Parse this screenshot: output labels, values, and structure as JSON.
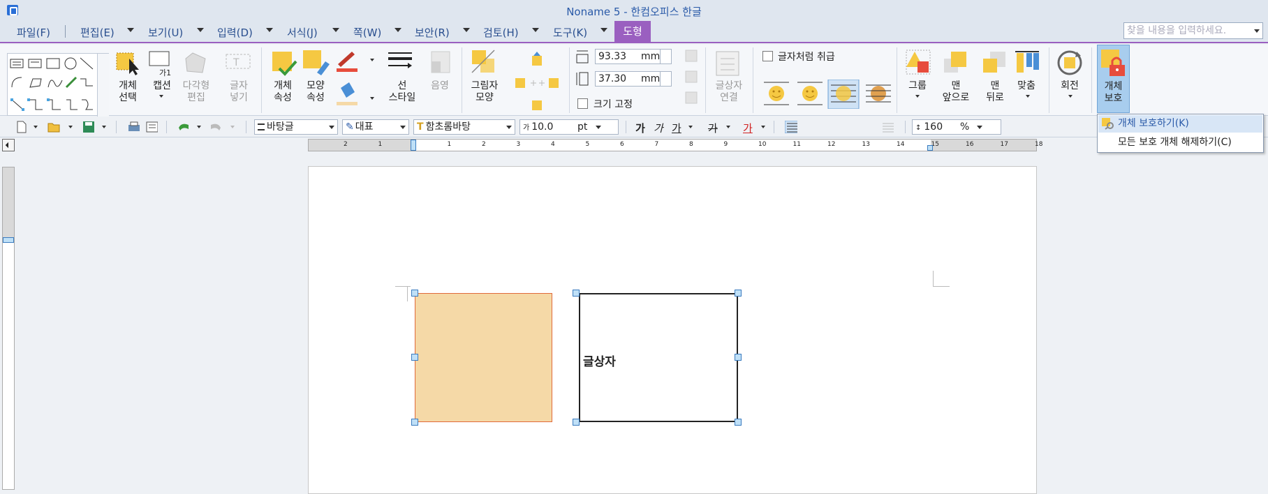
{
  "window": {
    "title": "Noname 5 - 한컴오피스 한글"
  },
  "menubar": {
    "items": [
      "파일(F)",
      "편집(E)",
      "보기(U)",
      "입력(D)",
      "서식(J)",
      "쪽(W)",
      "보안(R)",
      "검토(H)",
      "도구(K)"
    ],
    "active_tab": "도형",
    "search_placeholder": "찾을 내용을 입력하세요."
  },
  "ribbon": {
    "select_object": "개체\n선택",
    "caption": "캡션",
    "polygon_edit": "다각형\n편집",
    "insert_text": "글자\n넣기",
    "object_props": "개체\n속성",
    "shape_props": "모양\n속성",
    "line_style": "선\n스타일",
    "shade": "음영",
    "shadow_shape": "그림자\n모양",
    "width_value": "93.33",
    "height_value": "37.30",
    "unit": "mm",
    "fix_size": "크기 고정",
    "textbox_link": "글상자\n연결",
    "treat_as_char": "글자처럼 취급",
    "group": "그룹",
    "bring_front": "맨\n앞으로",
    "send_back": "맨\n뒤로",
    "align": "맞춤",
    "rotate": "회전",
    "protect": "개체\n보호"
  },
  "formatbar": {
    "style": "바탕글",
    "lang": "대표",
    "font": "함초롬바탕",
    "size": "10.0",
    "size_unit": "pt",
    "line_spacing": "160",
    "line_spacing_unit": "%"
  },
  "dropdown": {
    "items": [
      "개체 보호하기(K)",
      "모든 보호 개체 해제하기(C)"
    ]
  },
  "document": {
    "textbox_text": "글상자"
  },
  "ruler": {
    "h_numbers": [
      "2",
      "1",
      "",
      "1",
      "2",
      "3",
      "4",
      "5",
      "6",
      "7",
      "8",
      "9",
      "10",
      "11",
      "12",
      "13",
      "14",
      "15",
      "16",
      "17",
      "18"
    ]
  },
  "colors": {
    "accent": "#9a5fc0",
    "shape_fill": "#f5d9a7",
    "shape_border": "#e06a3a",
    "handle": "#bfe0f7"
  }
}
